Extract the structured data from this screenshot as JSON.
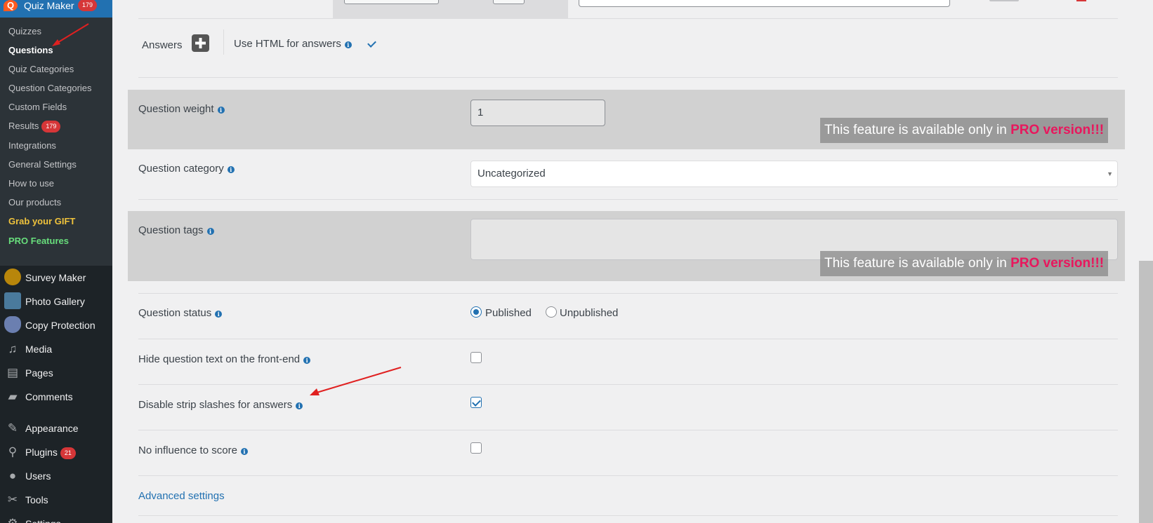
{
  "sidebar": {
    "plugin": {
      "title": "Quiz Maker",
      "badge": "179",
      "logo": "Q"
    },
    "submenu": [
      {
        "label": "Quizzes"
      },
      {
        "label": "Questions"
      },
      {
        "label": "Quiz Categories"
      },
      {
        "label": "Question Categories"
      },
      {
        "label": "Custom Fields"
      },
      {
        "label": "Results",
        "badge": "179"
      },
      {
        "label": "Integrations"
      },
      {
        "label": "General Settings"
      },
      {
        "label": "How to use"
      },
      {
        "label": "Our products"
      },
      {
        "label": "Grab your GIFT"
      },
      {
        "label": "PRO Features"
      }
    ],
    "menu": [
      {
        "label": "Survey Maker",
        "icon": "survey-maker-icon"
      },
      {
        "label": "Photo Gallery",
        "icon": "photo-gallery-icon"
      },
      {
        "label": "Copy Protection",
        "icon": "copy-protection-icon"
      },
      {
        "label": "Media",
        "icon": "media-icon"
      },
      {
        "label": "Pages",
        "icon": "pages-icon"
      },
      {
        "label": "Comments",
        "icon": "comments-icon"
      },
      {
        "label": "Appearance",
        "icon": "appearance-icon"
      },
      {
        "label": "Plugins",
        "icon": "plugins-icon",
        "badge": "21"
      },
      {
        "label": "Users",
        "icon": "users-icon"
      },
      {
        "label": "Tools",
        "icon": "tools-icon"
      },
      {
        "label": "Settings",
        "icon": "settings-icon"
      }
    ]
  },
  "form": {
    "answers": {
      "label": "Answers",
      "html_label": "Use HTML for answers",
      "html_checked": true
    },
    "pro_banner": {
      "prefix": "This feature is available only in ",
      "highlight": "PRO version!!!"
    },
    "weight": {
      "label": "Question weight",
      "value": "1"
    },
    "category": {
      "label": "Question category",
      "selected": "Uncategorized"
    },
    "tags": {
      "label": "Question tags"
    },
    "status": {
      "label": "Question status",
      "options": [
        "Published",
        "Unpublished"
      ],
      "selected": "Published"
    },
    "hide_text": {
      "label": "Hide question text on the front-end",
      "checked": false
    },
    "strip_slashes": {
      "label": "Disable strip slashes for answers",
      "checked": true
    },
    "no_influence": {
      "label": "No influence to score",
      "checked": false
    },
    "advanced_link": "Advanced settings"
  },
  "colors": {
    "sidebar": "#1d2327",
    "accent": "#2271b1",
    "pro_highlight": "#e8175d",
    "gift": "#f0c33c",
    "pro_features": "#68de7c",
    "annotation": "#e02020"
  }
}
